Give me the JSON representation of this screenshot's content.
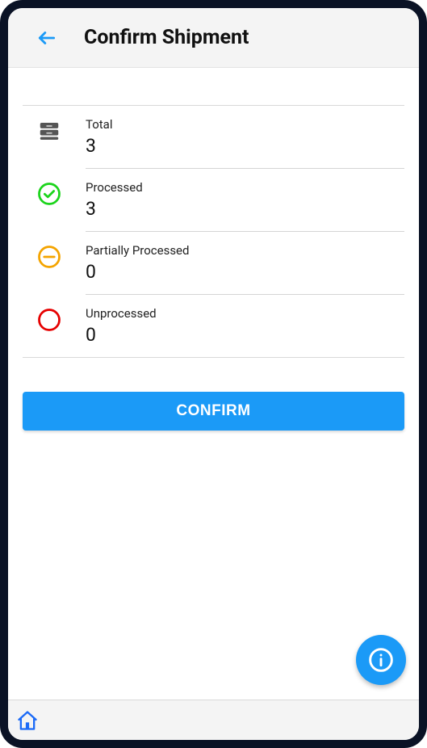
{
  "header": {
    "title": "Confirm Shipment"
  },
  "summary": {
    "total": {
      "label": "Total",
      "value": "3"
    },
    "processed": {
      "label": "Processed",
      "value": "3"
    },
    "partial": {
      "label": "Partially Processed",
      "value": "0"
    },
    "unprocessed": {
      "label": "Unprocessed",
      "value": "0"
    }
  },
  "actions": {
    "confirm_label": "CONFIRM"
  }
}
